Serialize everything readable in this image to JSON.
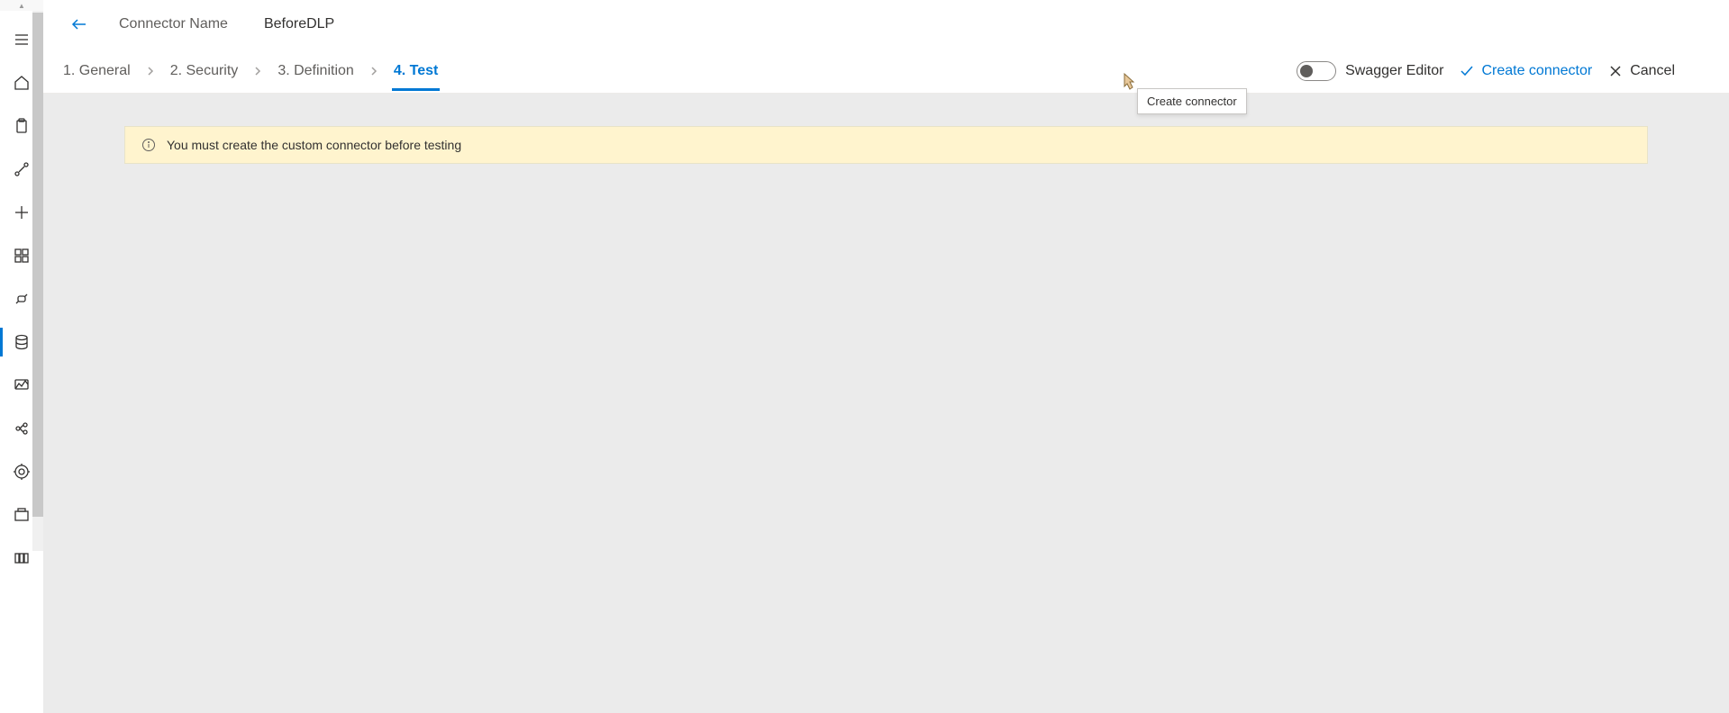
{
  "header": {
    "connector_label": "Connector Name",
    "connector_name": "BeforeDLP"
  },
  "steps": [
    {
      "label": "1. General",
      "active": false
    },
    {
      "label": "2. Security",
      "active": false
    },
    {
      "label": "3. Definition",
      "active": false
    },
    {
      "label": "4. Test",
      "active": true
    }
  ],
  "actions": {
    "swagger_toggle_label": "Swagger Editor",
    "swagger_toggle_on": false,
    "create_label": "Create connector",
    "cancel_label": "Cancel"
  },
  "banner": {
    "message": "You must create the custom connector before testing"
  },
  "tooltip": {
    "text": "Create connector"
  },
  "sidebar": {
    "items": [
      {
        "name": "hamburger-menu-icon"
      },
      {
        "name": "home-icon"
      },
      {
        "name": "clipboard-icon"
      },
      {
        "name": "flow-icon"
      },
      {
        "name": "plus-icon"
      },
      {
        "name": "templates-icon"
      },
      {
        "name": "connectors-icon"
      },
      {
        "name": "data-icon",
        "active": true
      },
      {
        "name": "monitor-icon"
      },
      {
        "name": "ai-builder-icon"
      },
      {
        "name": "process-advisor-icon"
      },
      {
        "name": "solutions-icon"
      },
      {
        "name": "more-icon"
      }
    ]
  }
}
